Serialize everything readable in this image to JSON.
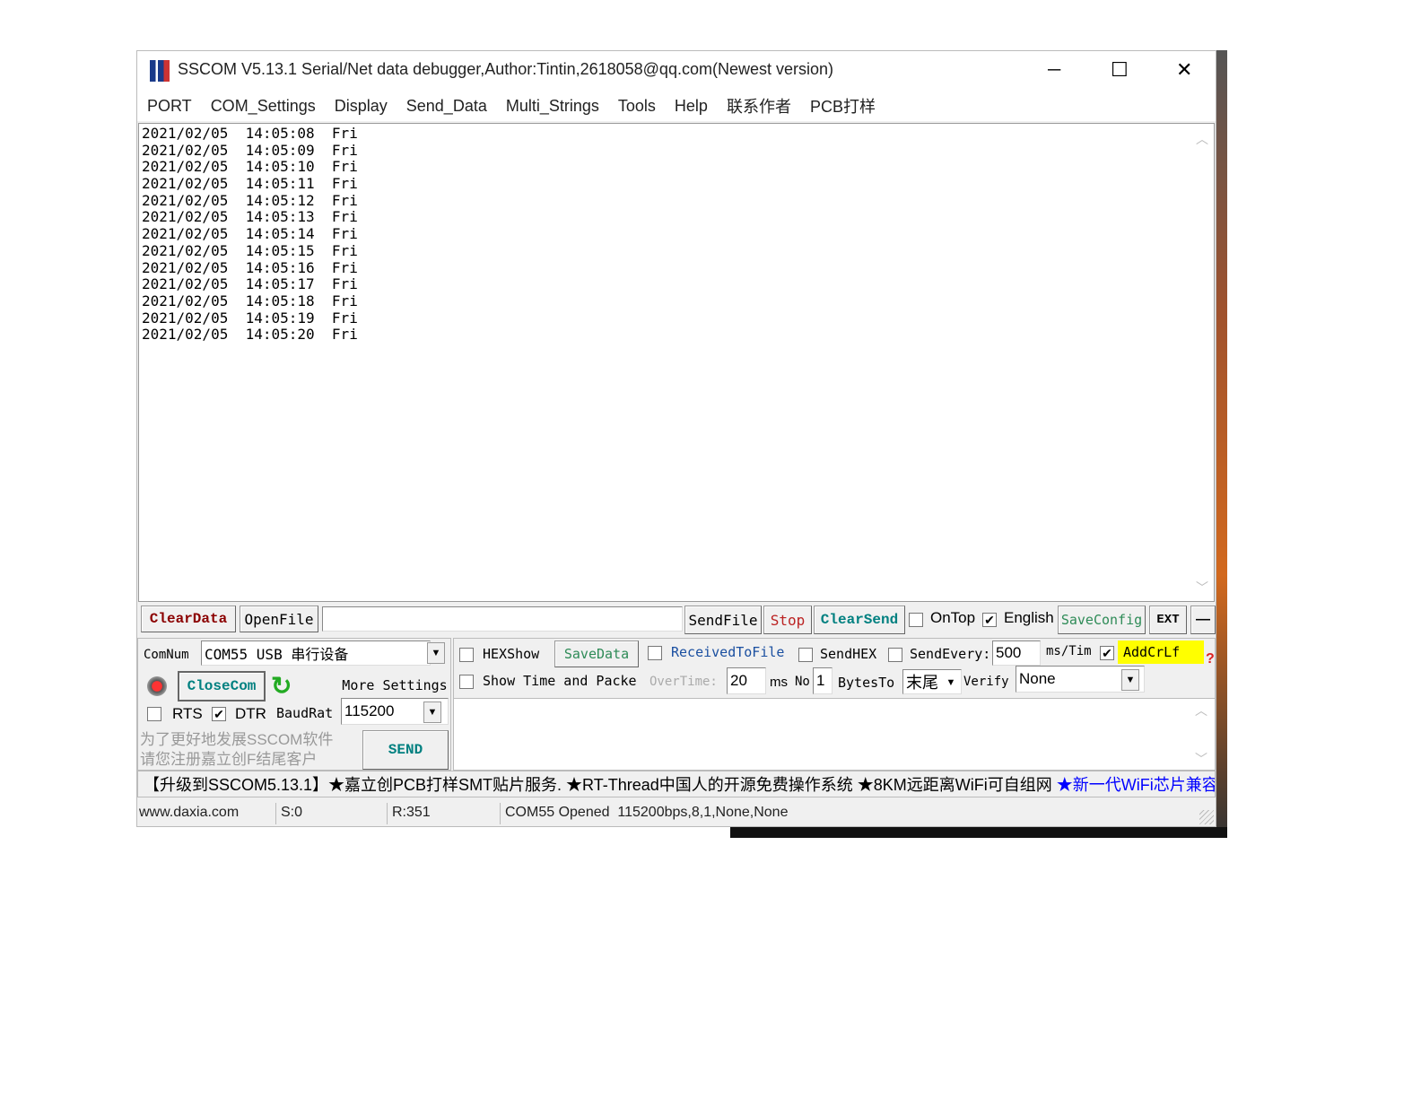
{
  "window": {
    "title": "SSCOM V5.13.1 Serial/Net data debugger,Author:Tintin,2618058@qq.com(Newest version)",
    "minimize": "─",
    "maximize": "☐",
    "close": "✕"
  },
  "menu": [
    "PORT",
    "COM_Settings",
    "Display",
    "Send_Data",
    "Multi_Strings",
    "Tools",
    "Help",
    "联系作者",
    "PCB打样"
  ],
  "receive_lines": [
    "2021/02/05  14:05:08  Fri",
    "2021/02/05  14:05:09  Fri",
    "2021/02/05  14:05:10  Fri",
    "2021/02/05  14:05:11  Fri",
    "2021/02/05  14:05:12  Fri",
    "2021/02/05  14:05:13  Fri",
    "2021/02/05  14:05:14  Fri",
    "2021/02/05  14:05:15  Fri",
    "2021/02/05  14:05:16  Fri",
    "2021/02/05  14:05:17  Fri",
    "2021/02/05  14:05:18  Fri",
    "2021/02/05  14:05:19  Fri",
    "2021/02/05  14:05:20  Fri"
  ],
  "toolbar": {
    "clear_data": "ClearData",
    "open_file": "OpenFile",
    "file_path": "",
    "send_file": "SendFile",
    "stop": "Stop",
    "clear_send": "ClearSend",
    "on_top": "OnTop",
    "on_top_checked": false,
    "english": "English",
    "english_checked": true,
    "save_config": "SaveConfig",
    "ext": "EXT",
    "collapse": "—"
  },
  "port": {
    "comnum_label": "ComNum",
    "comnum_value": "COM55 USB 串行设备",
    "close_com": "CloseCom",
    "more_settings": "More Settings",
    "rts": "RTS",
    "rts_checked": false,
    "dtr": "DTR",
    "dtr_checked": true,
    "baud_label": "BaudRat",
    "baud_value": "115200",
    "promo_line1": "为了更好地发展SSCOM软件",
    "promo_line2": "请您注册嘉立创F结尾客户",
    "send": "SEND"
  },
  "options": {
    "hex_show": "HEXShow",
    "save_data": "SaveData",
    "received_to_file": "ReceivedToFile",
    "send_hex": "SendHEX",
    "send_every": "SendEvery:",
    "send_every_value": "500",
    "ms_tim": "ms/Tim",
    "add_crlf": "AddCrLf",
    "add_crlf_checked": true,
    "show_time": "Show Time and Packe",
    "overtime": "OverTime:",
    "overtime_value": "20",
    "ms": "ms",
    "no": "No",
    "no_value": "1",
    "bytes_to": "BytesTo",
    "bytes_to_value": "末尾",
    "verify": "Verify",
    "verify_value": "None",
    "help": "?"
  },
  "send_text": "",
  "marquee": {
    "black": "【升级到SSCOM5.13.1】★嘉立创PCB打样SMT贴片服务. ★RT-Thread中国人的开源免费操作系统 ★8KM远距离WiFi可自组网 ",
    "blue": "★新一代WiFi芯片兼容"
  },
  "status": {
    "website": "www.daxia.com",
    "sent": "S:0",
    "received": "R:351",
    "port_status": "COM55 Opened  115200bps,8,1,None,None"
  },
  "colors": {
    "clear_data": "#8b0000",
    "save_green": "#2e8b57",
    "clear_send": "#008080",
    "addcrlf_bg": "#ffff00",
    "link_blue": "#0000ff"
  }
}
